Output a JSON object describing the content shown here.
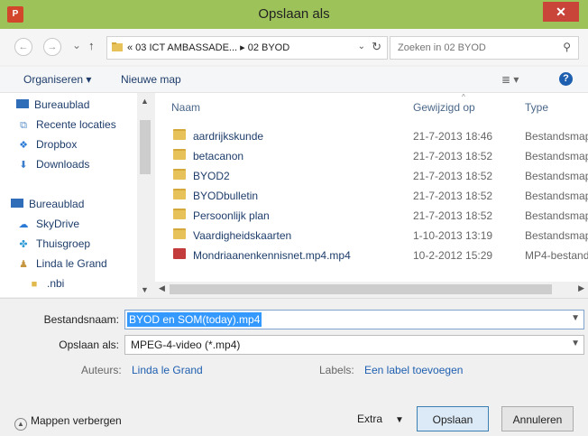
{
  "window": {
    "title": "Opslaan als",
    "app_icon_label": "P",
    "close_label": "✕"
  },
  "navigation": {
    "back": "←",
    "forward": "→",
    "recent_dropdown": "⌄",
    "up": "↑",
    "address": {
      "path": "« 03 ICT AMBASSADE... ▸ 02 BYOD",
      "dropdown": "⌄",
      "refresh": "↻"
    },
    "search": {
      "placeholder": "Zoeken in 02 BYOD"
    }
  },
  "toolbar": {
    "organize_label": "Organiseren ▾",
    "new_folder_label": "Nieuwe map",
    "view_icon": "≣ ▾",
    "help_label": "?"
  },
  "nav_pane": {
    "items": [
      {
        "label": "Bureaublad",
        "icon": "desktop-icon"
      },
      {
        "label": "Recente locaties",
        "icon": "recent-places-icon"
      },
      {
        "label": "Dropbox",
        "icon": "dropbox-icon"
      },
      {
        "label": "Downloads",
        "icon": "downloads-icon"
      },
      {
        "label": "Bureaublad",
        "icon": "desktop-icon"
      },
      {
        "label": "SkyDrive",
        "icon": "skydrive-icon"
      },
      {
        "label": "Thuisgroep",
        "icon": "homegroup-icon"
      },
      {
        "label": "Linda le Grand",
        "icon": "user-icon"
      },
      {
        "label": ".nbi",
        "icon": "folder-icon"
      }
    ]
  },
  "file_list": {
    "columns": {
      "name": "Naam",
      "date": "Gewijzigd op",
      "type": "Type"
    },
    "rows": [
      {
        "name": "aardrijkskunde",
        "date": "21-7-2013 18:46",
        "type": "Bestandsmap",
        "icon": "folder-icon"
      },
      {
        "name": "betacanon",
        "date": "21-7-2013 18:52",
        "type": "Bestandsmap",
        "icon": "folder-icon"
      },
      {
        "name": "BYOD2",
        "date": "21-7-2013 18:52",
        "type": "Bestandsmap",
        "icon": "folder-icon"
      },
      {
        "name": "BYODbulletin",
        "date": "21-7-2013 18:52",
        "type": "Bestandsmap",
        "icon": "folder-icon"
      },
      {
        "name": "Persoonlijk plan",
        "date": "21-7-2013 18:52",
        "type": "Bestandsmap",
        "icon": "folder-icon"
      },
      {
        "name": "Vaardigheidskaarten",
        "date": "1-10-2013 13:19",
        "type": "Bestandsmap",
        "icon": "folder-icon"
      },
      {
        "name": "Mondriaanenkennisnet.mp4.mp4",
        "date": "10-2-2012 15:29",
        "type": "MP4-bestand",
        "icon": "video-file-icon"
      }
    ]
  },
  "save_form": {
    "filename_label": "Bestandsnaam:",
    "filename_value": "BYOD en SOM(today).mp4",
    "filetype_label": "Opslaan als:",
    "filetype_value": "MPEG-4-video (*.mp4)",
    "authors_label": "Auteurs:",
    "authors_value": "Linda le Grand",
    "labels_label": "Labels:",
    "labels_value": "Een label toevoegen",
    "hide_folders_label": "Mappen verbergen",
    "extra_label": "Extra",
    "save_label": "Opslaan",
    "cancel_label": "Annuleren"
  }
}
